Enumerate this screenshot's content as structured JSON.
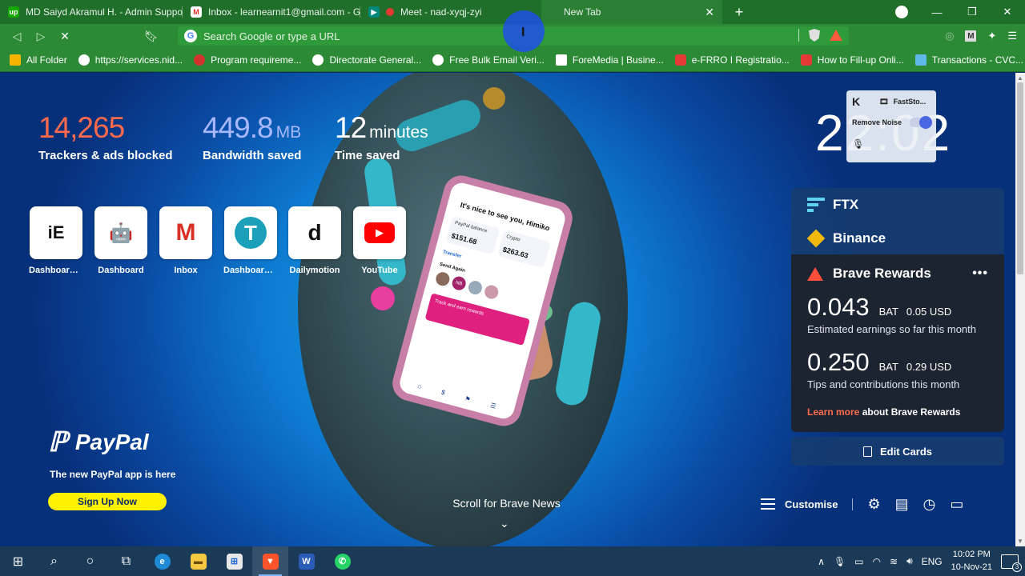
{
  "tabs": [
    {
      "title": "MD Saiyd Akramul H. - Admin Suppor",
      "icon": "upwork-icon",
      "color": "#14a800"
    },
    {
      "title": "Inbox - learnearnit1@gmail.com - Gm",
      "icon": "gmail-icon",
      "color": "#d93025"
    },
    {
      "title": "Meet - nad-xyqj-zyi",
      "icon": "meet-icon",
      "color": "#00897b"
    },
    {
      "title": "New Tab",
      "icon": "brave-icon",
      "color": "#ff5a3c",
      "active": true
    }
  ],
  "omnibox": {
    "placeholder": "Search Google or type a URL"
  },
  "toolbar": {
    "m_label": "M"
  },
  "bookmarks": [
    {
      "label": "All Folder",
      "color": "#f5b400"
    },
    {
      "label": "https://services.nid...",
      "color": "#ffffff"
    },
    {
      "label": "Program requireme...",
      "color": "#d0342c"
    },
    {
      "label": "Directorate General...",
      "color": "#ffffff"
    },
    {
      "label": "Free Bulk Email Veri...",
      "color": "#ffffff"
    },
    {
      "label": "ForeMedia | Busine...",
      "color": "#ffffff"
    },
    {
      "label": "e-FRRO I Registratio...",
      "color": "#e53935"
    },
    {
      "label": "How to Fill-up Onli...",
      "color": "#e53935"
    },
    {
      "label": "Transactions - CVC...",
      "color": "#5fb8e8"
    }
  ],
  "stats": {
    "trackers": {
      "value": "14,265",
      "label": "Trackers & ads blocked",
      "color": "#ff6a4d"
    },
    "bandwidth": {
      "value": "449.8",
      "unit": "MB",
      "label": "Bandwidth saved",
      "color": "#a8b8ff"
    },
    "time": {
      "value": "12",
      "unit": "minutes",
      "label": "Time saved"
    }
  },
  "top_sites": [
    {
      "label": "Dashboard ‹...",
      "glyph": "iE",
      "color": "#111111"
    },
    {
      "label": "Dashboard",
      "glyph": "🤖",
      "color": "#3a8ccf"
    },
    {
      "label": "Inbox",
      "glyph": "M",
      "color": "#d93025"
    },
    {
      "label": "Dashboard ‹...",
      "glyph": "T",
      "color": "#1aa0b8"
    },
    {
      "label": "Dailymotion",
      "glyph": "d",
      "color": "#111111"
    },
    {
      "label": "YouTube",
      "glyph": "▶",
      "color": "#ff0000"
    }
  ],
  "clock": "22:02",
  "faststone": {
    "title": "FastSto...",
    "remove_noise": "Remove Noise"
  },
  "cards": {
    "ftx": "FTX",
    "binance": "Binance",
    "rewards": {
      "title": "Brave Rewards",
      "earnings": {
        "bat": "0.043",
        "unit": "BAT",
        "usd": "0.05 USD",
        "desc": "Estimated earnings so far this month"
      },
      "tips": {
        "bat": "0.250",
        "unit": "BAT",
        "usd": "0.29 USD",
        "desc": "Tips and contributions this month"
      },
      "learn_link": "Learn more",
      "learn_rest": "about Brave Rewards"
    },
    "edit": "Edit Cards"
  },
  "paypal": {
    "logo": "PayPal",
    "tagline": "The new PayPal app is here",
    "cta": "Sign Up Now",
    "phone": {
      "greeting": "It's nice to see you, Himiko",
      "balance_label": "PayPal balance",
      "balance": "$151.68",
      "crypto_label": "Crypto",
      "crypto": "$263.63",
      "transfer": "Transfer",
      "send_again": "Send Again",
      "banner": "Track and earn rewards"
    }
  },
  "scroll_news": "Scroll for Brave News",
  "customise": "Customise",
  "taskbar": {
    "time": "10:02 PM",
    "date": "10-Nov-21",
    "lang": "ENG",
    "notifications": "3"
  }
}
